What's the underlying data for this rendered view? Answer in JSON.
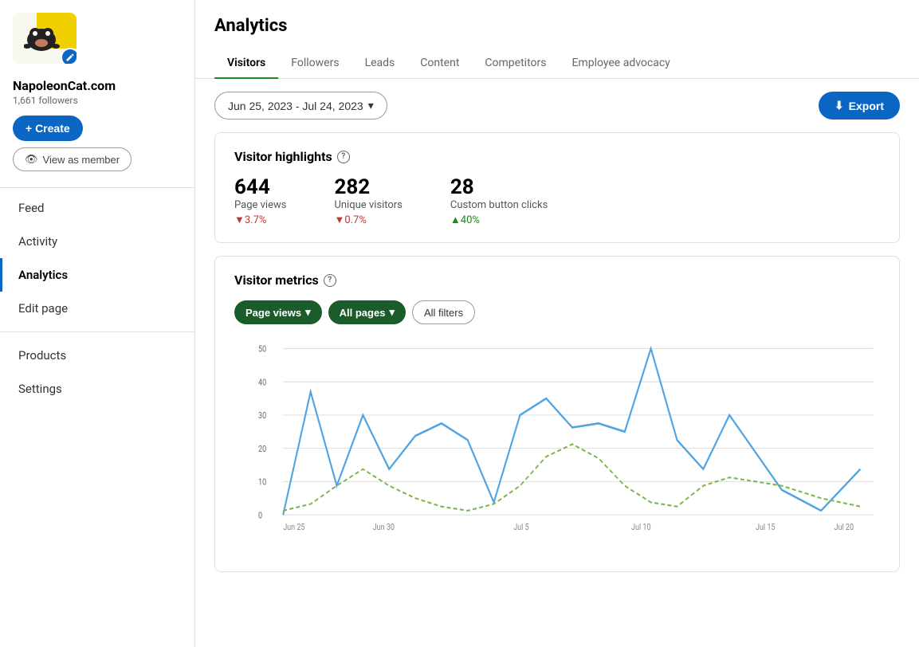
{
  "sidebar": {
    "company": {
      "name": "NapoleonCat.com",
      "followers": "1,661 followers"
    },
    "create_label": "+ Create",
    "view_member_label": "View as member",
    "nav_items": [
      {
        "id": "feed",
        "label": "Feed",
        "active": false
      },
      {
        "id": "activity",
        "label": "Activity",
        "active": false
      },
      {
        "id": "analytics",
        "label": "Analytics",
        "active": true
      },
      {
        "id": "edit-page",
        "label": "Edit page",
        "active": false
      },
      {
        "id": "products",
        "label": "Products",
        "active": false
      },
      {
        "id": "settings",
        "label": "Settings",
        "active": false
      }
    ]
  },
  "analytics": {
    "title": "Analytics",
    "tabs": [
      {
        "id": "visitors",
        "label": "Visitors",
        "active": true
      },
      {
        "id": "followers",
        "label": "Followers",
        "active": false
      },
      {
        "id": "leads",
        "label": "Leads",
        "active": false
      },
      {
        "id": "content",
        "label": "Content",
        "active": false
      },
      {
        "id": "competitors",
        "label": "Competitors",
        "active": false
      },
      {
        "id": "employee-advocacy",
        "label": "Employee advocacy",
        "active": false
      }
    ],
    "date_range": "Jun 25, 2023 - Jul 24, 2023",
    "export_label": "Export",
    "highlights": {
      "title": "Visitor highlights",
      "items": [
        {
          "value": "644",
          "label": "Page views",
          "change": "▼3.7%",
          "change_type": "down"
        },
        {
          "value": "282",
          "label": "Unique visitors",
          "change": "▼0.7%",
          "change_type": "down"
        },
        {
          "value": "28",
          "label": "Custom button clicks",
          "change": "▲40%",
          "change_type": "up"
        }
      ]
    },
    "metrics": {
      "title": "Visitor metrics",
      "filter_page_views": "Page views",
      "filter_all_pages": "All pages",
      "filter_all_filters": "All filters"
    },
    "chart": {
      "y_labels": [
        "50",
        "40",
        "30",
        "20",
        "10",
        "0"
      ],
      "x_labels": [
        "Jun 25",
        "Jun 30",
        "Jul 5",
        "Jul 10",
        "Jul 15",
        "Jul 20"
      ],
      "blue_line": [
        5,
        37,
        10,
        30,
        15,
        22,
        25,
        20,
        8,
        28,
        34,
        22,
        25,
        22,
        48,
        20,
        12,
        28,
        10,
        5,
        14
      ],
      "green_line": [
        2,
        3,
        8,
        12,
        7,
        5,
        3,
        2,
        4,
        6,
        13,
        18,
        14,
        6,
        3,
        2,
        7,
        8,
        5,
        3,
        2
      ]
    }
  }
}
